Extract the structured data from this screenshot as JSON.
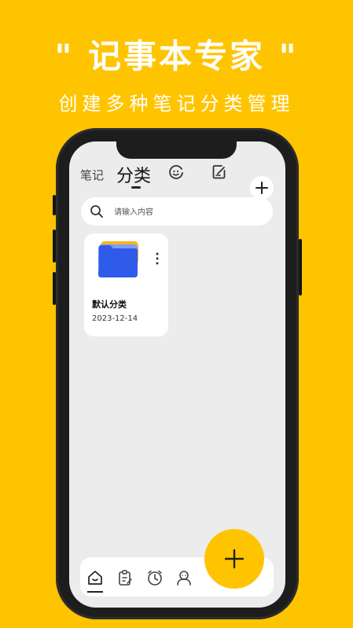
{
  "promo": {
    "headline": "\" 记事本专家 \"",
    "subline": "创建多种笔记分类管理"
  },
  "tabs": {
    "note_label": "笔记",
    "category_label": "分类",
    "icons": [
      "face-icon",
      "edit-note-icon",
      "plus-icon"
    ]
  },
  "search": {
    "placeholder": "请输入内容"
  },
  "categories": [
    {
      "name": "默认分类",
      "date": "2023-12-14",
      "icon": "folder-icon"
    }
  ],
  "bottom_nav": {
    "items": [
      "home-icon",
      "clipboard-icon",
      "clock-icon",
      "user-icon"
    ],
    "active": "home-icon"
  },
  "colors": {
    "background": "#FFC400",
    "folder_front": "#2F5BEA",
    "folder_back": "#F3B521",
    "folder_middle": "#7F9BF5",
    "fab": "#FFC400"
  }
}
